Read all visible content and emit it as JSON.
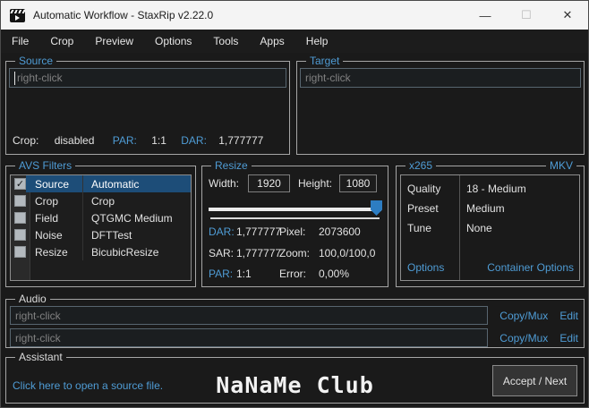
{
  "colors": {
    "accent_blue": "#4f9cd5",
    "selection_blue": "#1d4d78",
    "window_bg": "#1a1a1a",
    "titlebar_bg": "#f4f4f4",
    "group_border": "#a6a6a6"
  },
  "titlebar": {
    "title": "Automatic Workflow - StaxRip v2.22.0",
    "minimize": "—",
    "maximize": "☐",
    "close": "✕"
  },
  "menu": {
    "items": [
      "File",
      "Crop",
      "Preview",
      "Options",
      "Tools",
      "Apps",
      "Help"
    ]
  },
  "source": {
    "label": "Source",
    "placeholder": "right-click",
    "info": {
      "crop_label": "Crop:",
      "crop_value": "disabled",
      "par_label": "PAR:",
      "par_value": "1:1",
      "dar_label": "DAR:",
      "dar_value": "1,777777"
    }
  },
  "target": {
    "label": "Target",
    "placeholder": "right-click"
  },
  "avs_filters": {
    "label": "AVS Filters",
    "rows": [
      {
        "check": "✓",
        "name": "Source",
        "value": "Automatic"
      },
      {
        "check": "",
        "name": "Crop",
        "value": "Crop"
      },
      {
        "check": "",
        "name": "Field",
        "value": "QTGMC Medium"
      },
      {
        "check": "",
        "name": "Noise",
        "value": "DFTTest"
      },
      {
        "check": "",
        "name": "Resize",
        "value": "BicubicResize"
      }
    ]
  },
  "resize": {
    "label": "Resize",
    "width_label": "Width:",
    "width_value": "1920",
    "height_label": "Height:",
    "height_value": "1080",
    "rows": [
      {
        "l1": "DAR:",
        "v1": "1,777777",
        "l2": "Pixel:",
        "v2": "2073600"
      },
      {
        "l1": "SAR:",
        "v1": "1,777777",
        "l2": "Zoom:",
        "v2": "100,0/100,0"
      },
      {
        "l1": "PAR:",
        "v1": "1:1",
        "l2": "Error:",
        "v2": "0,00%"
      }
    ]
  },
  "encoder": {
    "label": "x265",
    "container": "MKV",
    "rows": [
      {
        "key": "Quality",
        "value": "18 - Medium"
      },
      {
        "key": "Preset",
        "value": "Medium"
      },
      {
        "key": "Tune",
        "value": "None"
      }
    ],
    "options_link": "Options",
    "container_options_link": "Container Options"
  },
  "audio": {
    "label": "Audio",
    "tracks": [
      {
        "placeholder": "right-click",
        "mux_link": "Copy/Mux",
        "edit_link": "Edit"
      },
      {
        "placeholder": "right-click",
        "mux_link": "Copy/Mux",
        "edit_link": "Edit"
      }
    ]
  },
  "assistant": {
    "label": "Assistant",
    "link": "Click here to open a source file.",
    "button": "Accept / Next",
    "watermark": "NaNaMe Club"
  }
}
